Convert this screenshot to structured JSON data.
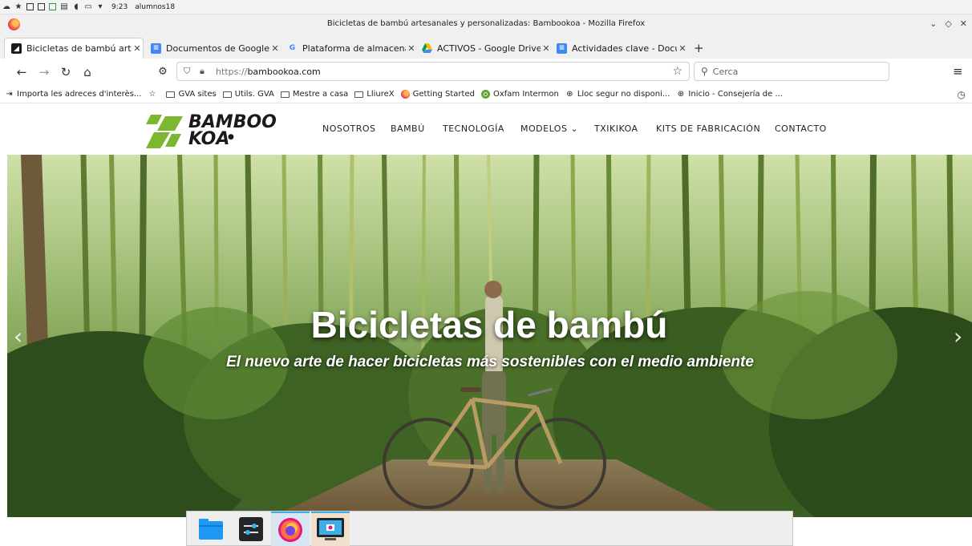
{
  "system_panel": {
    "time": "9:23",
    "user": "alumnos18"
  },
  "window": {
    "title": "Bicicletas de bambú artesanales y personalizadas: Bambookoa - Mozilla Firefox"
  },
  "tabs": [
    {
      "label": "Bicicletas de bambú artesa",
      "icon": "bambookoa-favicon",
      "active": true
    },
    {
      "label": "Documentos de Google",
      "icon": "google-docs-icon",
      "active": false
    },
    {
      "label": "Plataforma de almacenam",
      "icon": "google-g-icon",
      "active": false
    },
    {
      "label": "ACTIVOS - Google Drive",
      "icon": "google-drive-icon",
      "active": false
    },
    {
      "label": "Actividades clave - Docume",
      "icon": "google-docs-icon",
      "active": false
    }
  ],
  "navbar": {
    "url_scheme": "https://",
    "url_host": "bambookoa.com",
    "search_placeholder": "Cerca"
  },
  "bookmarks": [
    {
      "label": "Importa les adreces d'interès...",
      "icon": "import-icon"
    },
    {
      "label": "",
      "icon": "bookmark-star-icon"
    },
    {
      "label": "GVA sites",
      "icon": "folder-icon"
    },
    {
      "label": "Utils. GVA",
      "icon": "folder-icon"
    },
    {
      "label": "Mestre a casa",
      "icon": "folder-icon"
    },
    {
      "label": "LliureX",
      "icon": "folder-icon"
    },
    {
      "label": "Getting Started",
      "icon": "firefox-icon"
    },
    {
      "label": "Oxfam Intermon",
      "icon": "oxfam-icon"
    },
    {
      "label": "Lloc segur no disponi...",
      "icon": "globe-icon"
    },
    {
      "label": "Inicio - Consejería de ...",
      "icon": "globe-icon"
    }
  ],
  "site": {
    "logo_line1": "BAMBOO",
    "logo_line2": "KOA",
    "nav": [
      "NOSOTROS",
      "BAMBÚ",
      "TECNOLOGÍA",
      "MODELOS ⌄",
      "TXIKIKOA",
      "KITS DE FABRICACIÓN",
      "CONTACTO"
    ],
    "hero_title": "Bicicletas de bambú",
    "hero_subtitle": "El nuevo arte de hacer bicicletas más sostenibles con el medio ambiente"
  },
  "taskbar": {
    "apps": [
      "file-manager-icon",
      "system-settings-icon",
      "firefox-icon",
      "screenshot-tool-icon"
    ]
  },
  "colors": {
    "brand_green": "#7cb82f",
    "firefox_orange": "#ff7139",
    "kde_blue": "#3daee9"
  }
}
